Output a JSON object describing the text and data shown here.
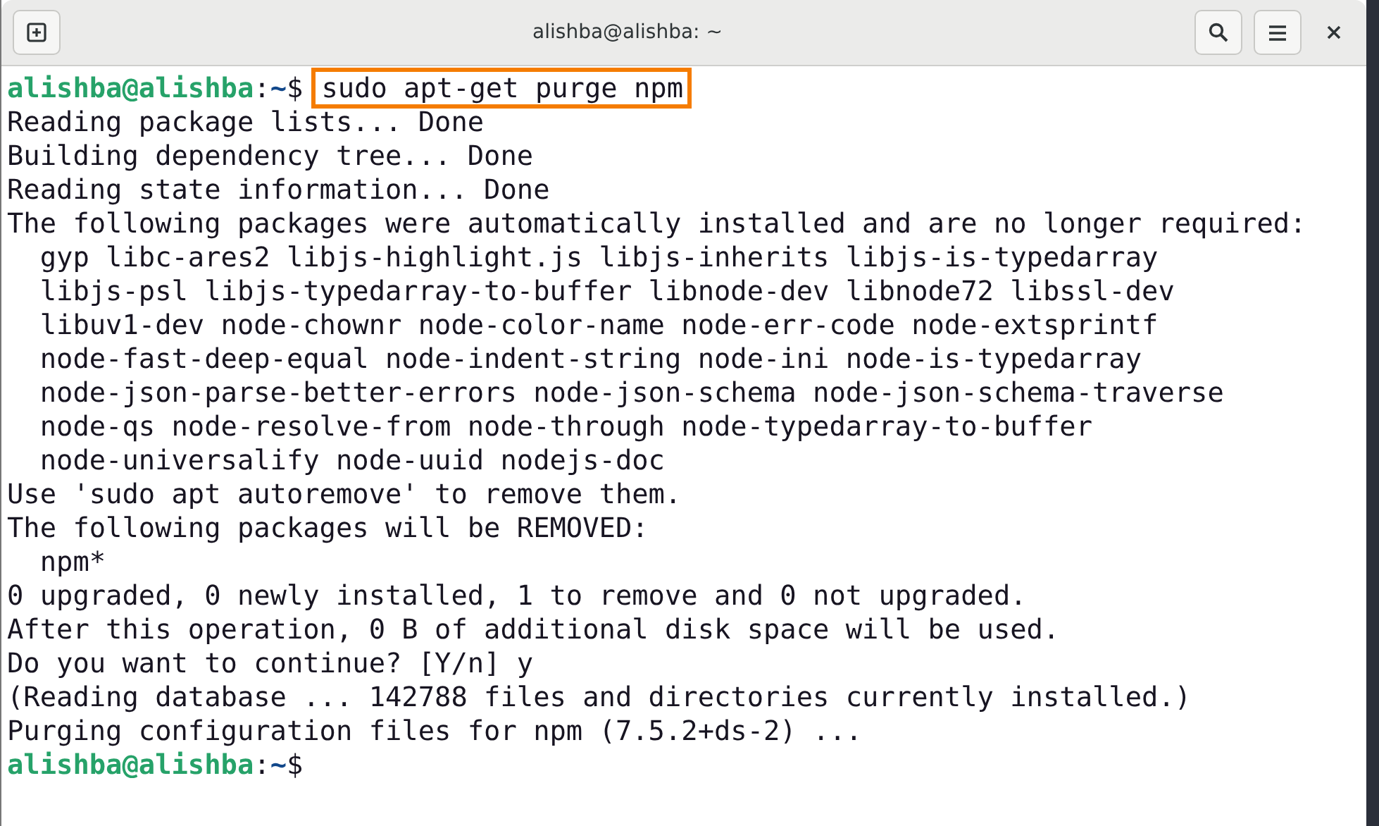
{
  "window": {
    "title": "alishba@alishba: ~"
  },
  "lines": [
    {
      "kind": "prompt",
      "user_host": "alishba@alishba",
      "separator": ":",
      "path": "~",
      "symbol": "$",
      "command": "sudo apt-get purge npm",
      "highlighted": true
    },
    {
      "kind": "output",
      "text": "Reading package lists... Done"
    },
    {
      "kind": "output",
      "text": "Building dependency tree... Done"
    },
    {
      "kind": "output",
      "text": "Reading state information... Done"
    },
    {
      "kind": "output",
      "text": "The following packages were automatically installed and are no longer required:"
    },
    {
      "kind": "output",
      "text": "  gyp libc-ares2 libjs-highlight.js libjs-inherits libjs-is-typedarray"
    },
    {
      "kind": "output",
      "text": "  libjs-psl libjs-typedarray-to-buffer libnode-dev libnode72 libssl-dev"
    },
    {
      "kind": "output",
      "text": "  libuv1-dev node-chownr node-color-name node-err-code node-extsprintf"
    },
    {
      "kind": "output",
      "text": "  node-fast-deep-equal node-indent-string node-ini node-is-typedarray"
    },
    {
      "kind": "output",
      "text": "  node-json-parse-better-errors node-json-schema node-json-schema-traverse"
    },
    {
      "kind": "output",
      "text": "  node-qs node-resolve-from node-through node-typedarray-to-buffer"
    },
    {
      "kind": "output",
      "text": "  node-universalify node-uuid nodejs-doc"
    },
    {
      "kind": "output",
      "text": "Use 'sudo apt autoremove' to remove them."
    },
    {
      "kind": "output",
      "text": "The following packages will be REMOVED:"
    },
    {
      "kind": "output",
      "text": "  npm*"
    },
    {
      "kind": "output",
      "text": "0 upgraded, 0 newly installed, 1 to remove and 0 not upgraded."
    },
    {
      "kind": "output",
      "text": "After this operation, 0 B of additional disk space will be used."
    },
    {
      "kind": "output",
      "text": "Do you want to continue? [Y/n] y"
    },
    {
      "kind": "output",
      "text": "(Reading database ... 142788 files and directories currently installed.)"
    },
    {
      "kind": "output",
      "text": "Purging configuration files for npm (7.5.2+ds-2) ..."
    },
    {
      "kind": "prompt",
      "user_host": "alishba@alishba",
      "separator": ":",
      "path": "~",
      "symbol": "$"
    }
  ]
}
